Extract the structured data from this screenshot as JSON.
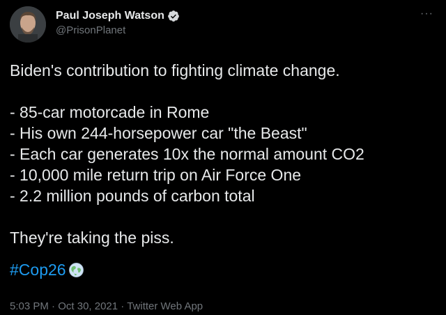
{
  "author": {
    "display_name": "Paul Joseph Watson",
    "handle": "@PrisonPlanet",
    "verified_icon": "verified-badge-icon",
    "avatar": "avatar"
  },
  "more_icon": "more-options-icon",
  "tweet": {
    "lead": "Biden's contribution to fighting climate change.",
    "bullets": [
      "- 85-car motorcade in Rome",
      "- His own 244-horsepower car \"the Beast\"",
      "- Each car generates 10x the normal amount CO2",
      "- 10,000 mile return trip on Air Force One",
      "- 2.2 million pounds of carbon total"
    ],
    "closing": "They're taking the piss.",
    "hashtag": "#Cop26",
    "hashtag_emoji_icon": "globe-emoji-icon"
  },
  "meta": {
    "time": "5:03 PM",
    "sep1": " · ",
    "date": "Oct 30, 2021",
    "sep2": " · ",
    "source": "Twitter Web App"
  },
  "colors": {
    "background": "#000000",
    "text": "#e7e9ea",
    "secondary": "#71767b",
    "link": "#1d9bf0",
    "verified": "#d6d9db"
  }
}
